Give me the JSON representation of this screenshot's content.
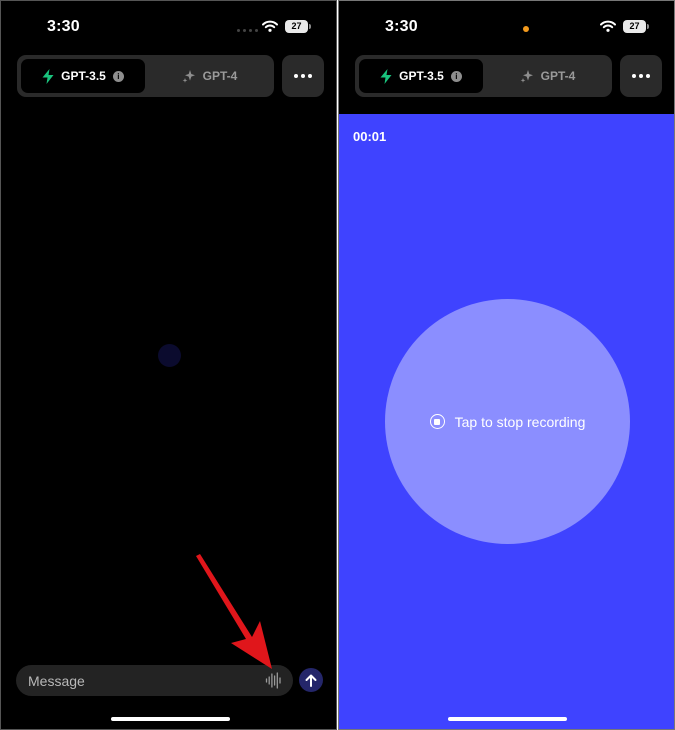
{
  "left_phone": {
    "status": {
      "time": "3:30",
      "battery": "27"
    },
    "models": {
      "active": "GPT-3.5",
      "inactive": "GPT-4",
      "info_symbol": "i"
    },
    "composer": {
      "placeholder": "Message"
    }
  },
  "right_phone": {
    "status": {
      "time": "3:30",
      "battery": "27"
    },
    "models": {
      "active": "GPT-3.5",
      "inactive": "GPT-4",
      "info_symbol": "i"
    },
    "recording": {
      "timer": "00:01",
      "stop_label": "Tap to stop recording"
    }
  },
  "icons": [
    "wifi-icon",
    "bolt-icon",
    "info-icon",
    "sparkles-icon",
    "more-icon",
    "voice-waveform-icon",
    "arrow-up-icon",
    "stop-icon"
  ],
  "colors": {
    "background": "#000000",
    "recording_blue": "#3f43ff",
    "record_circle": "#8b8eff",
    "bolt_green": "#19c37d",
    "annotation_arrow": "#e0161b",
    "mic_indicator": "#f39a1d"
  }
}
